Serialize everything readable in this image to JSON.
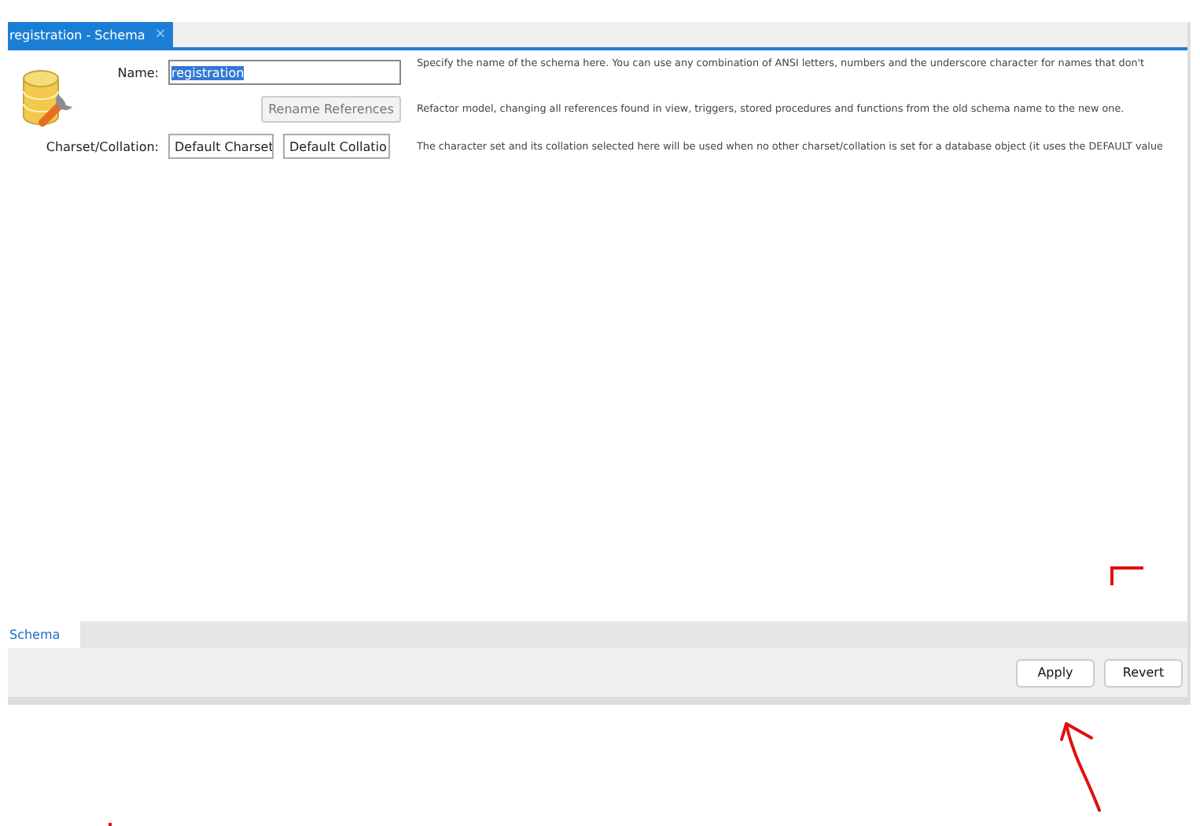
{
  "tab": {
    "title": "registration - Schema",
    "close": "×",
    "selected": true
  },
  "form": {
    "name_label": "Name:",
    "name_value": "registration",
    "name_selected": true,
    "rename_button": {
      "label": "Rename References",
      "disabled": true
    },
    "charset_label": "Charset/Collation:",
    "charset": "Default Charset",
    "collation": "Default Collatio"
  },
  "descriptions": [
    "Specify the name of the schema here. You can use any combination of ANSI letters, numbers and the underscore character for names that don't",
    "Refactor model, changing all references found in view, triggers, stored procedures and functions from the old schema name to the new one.",
    "The character set and its collation selected here will be used when no other charset/collation is set for a database object (it uses the DEFAULT value"
  ],
  "bottom_tabs": [
    {
      "label": "Schema",
      "selected": true
    }
  ],
  "buttons": [
    {
      "label": "Apply"
    },
    {
      "label": "Revert"
    }
  ]
}
